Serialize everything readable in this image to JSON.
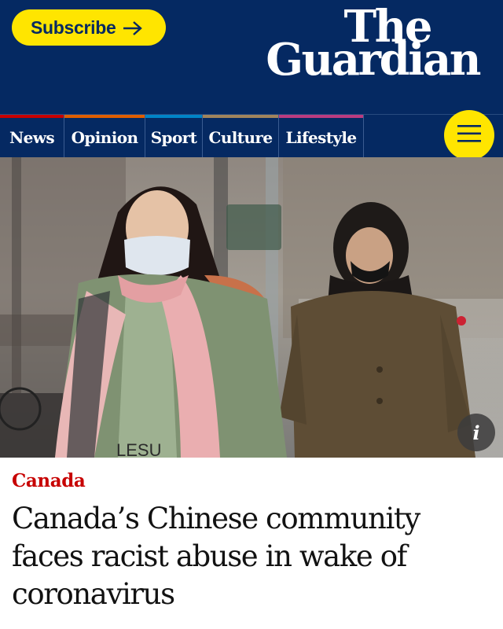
{
  "header": {
    "subscribe_label": "Subscribe",
    "logo_line1": "The",
    "logo_line2": "Guardian"
  },
  "nav": {
    "items": [
      {
        "label": "News",
        "color": "#c70000"
      },
      {
        "label": "Opinion",
        "color": "#e05e00"
      },
      {
        "label": "Sport",
        "color": "#0084c6"
      },
      {
        "label": "Culture",
        "color": "#a1845c"
      },
      {
        "label": "Lifestyle",
        "color": "#bb3b80"
      }
    ],
    "menu_icon": "hamburger-menu-icon"
  },
  "hero": {
    "info_label": "i",
    "sign_text": "LESU"
  },
  "article": {
    "kicker": "Canada",
    "headline": "Canada’s Chinese community faces racist abuse in wake of coronavirus"
  },
  "colors": {
    "brand_blue": "#052962",
    "accent_yellow": "#ffe500",
    "kicker_red": "#c70000"
  }
}
